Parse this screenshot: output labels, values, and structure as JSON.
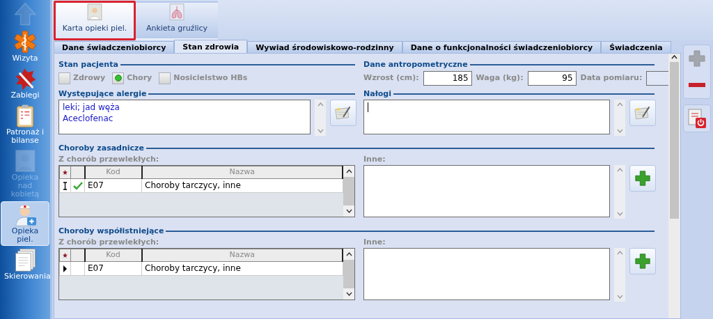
{
  "sidebar": {
    "items": [
      {
        "kind": "up",
        "disabled": true,
        "selected": false
      },
      {
        "kind": "visit",
        "label": "Wizyta",
        "disabled": false,
        "selected": false
      },
      {
        "kind": "procedure",
        "label": "Zabiegi",
        "disabled": false,
        "selected": false
      },
      {
        "kind": "clipboard",
        "label": "Patronaż i bilanse",
        "disabled": false,
        "selected": false
      },
      {
        "kind": "woman",
        "label": "Opieka nad kobietą",
        "disabled": true,
        "selected": false
      },
      {
        "kind": "nurse",
        "label": "Opieka piel.",
        "disabled": false,
        "selected": true
      },
      {
        "kind": "docs",
        "label": "Skierowania",
        "disabled": false,
        "selected": false
      }
    ]
  },
  "toolbar": [
    {
      "kind": "card",
      "label": "Karta opieki piel.",
      "selected": true
    },
    {
      "kind": "lungs",
      "label": "Ankieta gruźlicy",
      "selected": false
    }
  ],
  "tabs": [
    {
      "label": "Dane świadczeniobiorcy",
      "selected": false
    },
    {
      "label": "Stan zdrowia",
      "selected": true
    },
    {
      "label": "Wywiad środowiskowo-rodzinny",
      "selected": false
    },
    {
      "label": "Dane o funkcjonalności świadczeniobiorcy",
      "selected": false
    },
    {
      "label": "Świadczenia",
      "selected": false
    }
  ],
  "patient_state": {
    "title": "Stan pacjenta",
    "options": [
      {
        "label": "Zdrowy",
        "checked": false
      },
      {
        "label": "Chory",
        "checked": true
      },
      {
        "label": "Nosicielstwo HBs",
        "checked": false
      }
    ]
  },
  "anthropometry": {
    "title": "Dane antropometryczne",
    "fields": [
      {
        "label": "Wzrost (cm):",
        "value": "185",
        "disabled": false
      },
      {
        "label": "Waga (kg):",
        "value": "95",
        "disabled": false
      },
      {
        "label": "Data pomiaru:",
        "disabled": true
      }
    ]
  },
  "allergies": {
    "title": "Występujące alergie",
    "lines": [
      "leki; jad węża",
      "Aceclofenac"
    ]
  },
  "addictions": {
    "title": "Nałogi",
    "focused": true
  },
  "disease_sections": [
    {
      "title": "Choroby zasadnicze",
      "sublabel": "Z chorób przewlekłych:",
      "columns": [
        "Kod",
        "Nazwa"
      ],
      "rows": [
        {
          "kind": "editing",
          "checked": true,
          "code": "E07",
          "name": "Choroby tarczycy, inne"
        }
      ],
      "other_label": "Inne:"
    },
    {
      "title": "Choroby współistniejące",
      "sublabel": "Z chorób przewlekłych:",
      "columns": [
        "Kod",
        "Nazwa"
      ],
      "rows": [
        {
          "kind": "current",
          "checked": false,
          "code": "E07",
          "name": "Choroby tarczycy, inne"
        }
      ],
      "other_label": "Inne:"
    }
  ],
  "side_buttons": [
    {
      "kind": "add",
      "disabled": true
    },
    {
      "kind": "remove",
      "disabled": false
    },
    {
      "kind": "close",
      "disabled": false
    }
  ]
}
